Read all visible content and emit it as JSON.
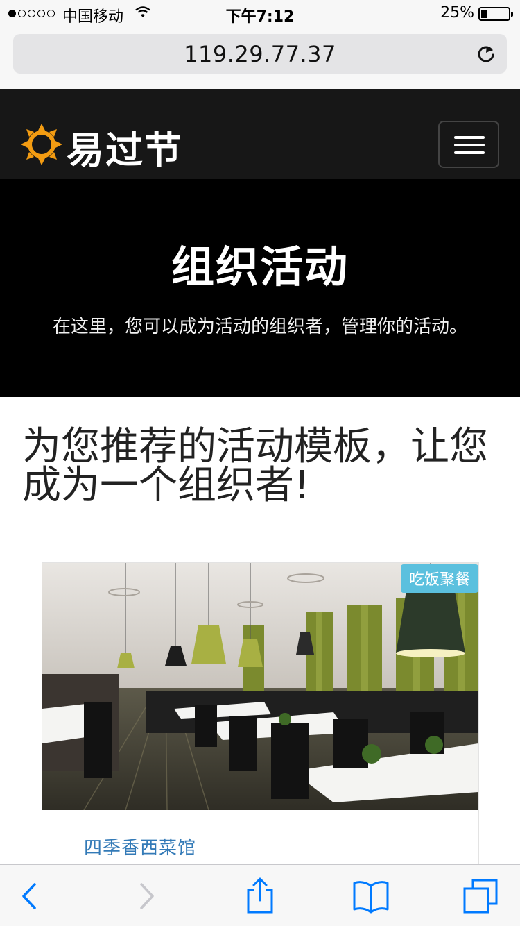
{
  "status_bar": {
    "carrier": "中国移动",
    "time": "下午7:12",
    "battery": "25%",
    "signal_strength": 1,
    "battery_level": 0.25
  },
  "browser": {
    "url": "119.29.77.37"
  },
  "navbar": {
    "brand": "易过节",
    "brand_color": "#f39c12"
  },
  "hero": {
    "title": "组织活动",
    "subtitle": "在这里，您可以成为活动的组织者，管理你的活动。"
  },
  "section": {
    "title": "为您推荐的活动模板，让您成为一个组织者!"
  },
  "cards": [
    {
      "category": "吃饭聚餐",
      "title": "四季香西菜馆"
    }
  ],
  "colors": {
    "navbar_bg": "#171717",
    "hero_bg": "#000000",
    "badge": "#5bc0de",
    "link": "#337ab7",
    "ios_blue": "#007aff"
  }
}
